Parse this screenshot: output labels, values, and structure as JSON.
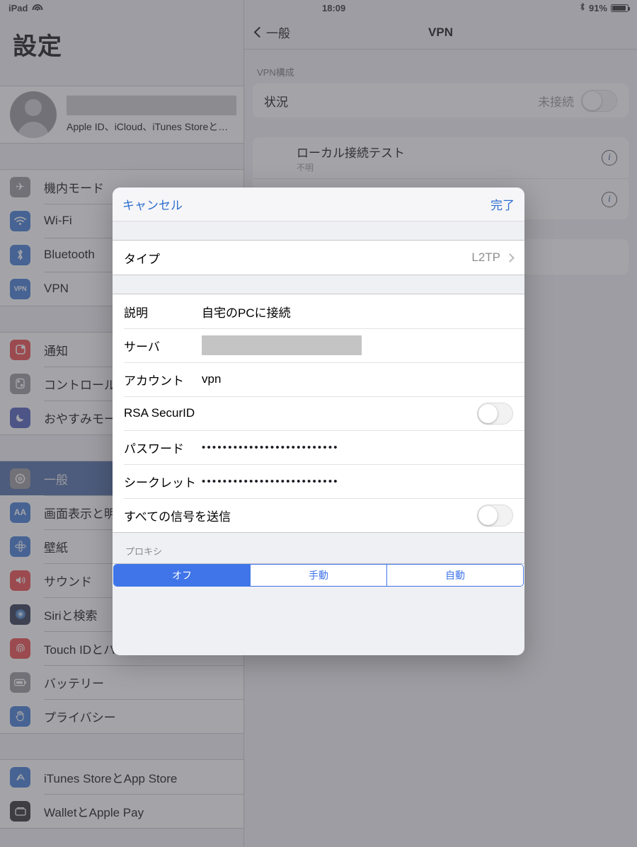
{
  "status_bar": {
    "device": "iPad",
    "wifi_icon": "wifi-icon",
    "time": "18:09",
    "bluetooth_icon": "bluetooth-icon",
    "battery_percent": "91%"
  },
  "sidebar": {
    "title": "設定",
    "account": {
      "name_redacted": "",
      "subtitle": "Apple ID、iCloud、iTunes Storeと…",
      "avatar_icon": "person-avatar-icon"
    },
    "groups": [
      {
        "items": [
          {
            "label": "機内モード",
            "icon": "airplane-icon",
            "icon_class": "ico-plane",
            "glyph": "✈",
            "selected": false
          },
          {
            "label": "Wi-Fi",
            "icon": "wifi-icon",
            "icon_class": "ico-wifi",
            "glyph": "◖",
            "selected": false
          },
          {
            "label": "Bluetooth",
            "icon": "bluetooth-icon",
            "icon_class": "ico-bt",
            "glyph": "✲",
            "selected": false
          },
          {
            "label": "VPN",
            "icon": "vpn-icon",
            "icon_class": "ico-vpn",
            "glyph": "VPN",
            "selected": false
          }
        ]
      },
      {
        "items": [
          {
            "label": "通知",
            "icon": "notifications-icon",
            "icon_class": "ico-notif",
            "glyph": "▣",
            "selected": false
          },
          {
            "label": "コントロールセンター",
            "icon": "control-center-icon",
            "icon_class": "ico-control",
            "glyph": "◉",
            "selected": false
          },
          {
            "label": "おやすみモード",
            "icon": "do-not-disturb-icon",
            "icon_class": "ico-dnd",
            "glyph": "☾",
            "selected": false
          }
        ]
      },
      {
        "items": [
          {
            "label": "一般",
            "icon": "gear-icon",
            "icon_class": "ico-general",
            "glyph": "⚙",
            "selected": true
          },
          {
            "label": "画面表示と明るさ",
            "icon": "display-brightness-icon",
            "icon_class": "ico-display",
            "glyph": "AA",
            "selected": false
          },
          {
            "label": "壁紙",
            "icon": "wallpaper-icon",
            "icon_class": "ico-wall",
            "glyph": "✿",
            "selected": false
          },
          {
            "label": "サウンド",
            "icon": "sound-icon",
            "icon_class": "ico-sound",
            "glyph": "◀",
            "selected": false
          },
          {
            "label": "Siriと検索",
            "icon": "siri-icon",
            "icon_class": "ico-siri",
            "glyph": "◉",
            "selected": false
          },
          {
            "label": "Touch IDとパスコード",
            "icon": "touch-id-icon",
            "icon_class": "ico-touch",
            "glyph": "◎",
            "selected": false
          },
          {
            "label": "バッテリー",
            "icon": "battery-icon",
            "icon_class": "ico-batt",
            "glyph": "▭",
            "selected": false
          },
          {
            "label": "プライバシー",
            "icon": "privacy-icon",
            "icon_class": "ico-priv",
            "glyph": "✋",
            "selected": false
          }
        ]
      },
      {
        "items": [
          {
            "label": "iTunes StoreとApp Store",
            "icon": "app-store-icon",
            "icon_class": "ico-itunes",
            "glyph": "A",
            "selected": false
          },
          {
            "label": "WalletとApple Pay",
            "icon": "wallet-icon",
            "icon_class": "ico-wallet",
            "glyph": "▤",
            "selected": false
          }
        ]
      }
    ]
  },
  "detail": {
    "back_label": "一般",
    "title": "VPN",
    "section_header": "VPN構成",
    "status_row": {
      "label": "状況",
      "value": "未接続",
      "toggle_on": false
    },
    "configs": [
      {
        "label": "ローカル接続テスト",
        "sub": "不明",
        "info_icon": "info-icon"
      },
      {
        "label": "",
        "sub": "",
        "info_icon": "info-icon"
      }
    ]
  },
  "modal": {
    "cancel_label": "キャンセル",
    "done_label": "完了",
    "type_row": {
      "label": "タイプ",
      "value": "L2TP",
      "chevron": "chevron-right-icon"
    },
    "fields": [
      {
        "name": "description",
        "label": "説明",
        "value": "自宅のPCに接続",
        "kind": "text"
      },
      {
        "name": "server",
        "label": "サーバ",
        "value": "",
        "kind": "redacted"
      },
      {
        "name": "account",
        "label": "アカウント",
        "value": "vpn",
        "kind": "text"
      },
      {
        "name": "rsa-securid",
        "label": "RSA SecurID",
        "value": "",
        "kind": "toggle",
        "toggle_on": false
      },
      {
        "name": "password",
        "label": "パスワード",
        "value": "••••••••••••••••••••••••••",
        "kind": "secure"
      },
      {
        "name": "secret",
        "label": "シークレット",
        "value": "••••••••••••••••••••••••••",
        "kind": "secure"
      },
      {
        "name": "send-all-traffic",
        "label": "すべての信号を送信",
        "value": "",
        "kind": "toggle",
        "toggle_on": false
      }
    ],
    "proxy": {
      "header": "プロキシ",
      "options": [
        "オフ",
        "手動",
        "自動"
      ],
      "selected_index": 0
    }
  },
  "colors": {
    "accent_blue": "#3f75e8",
    "link_blue": "#2f6fd0",
    "selected_row": "#3f5f9e",
    "panel_bg": "#efeff4"
  }
}
